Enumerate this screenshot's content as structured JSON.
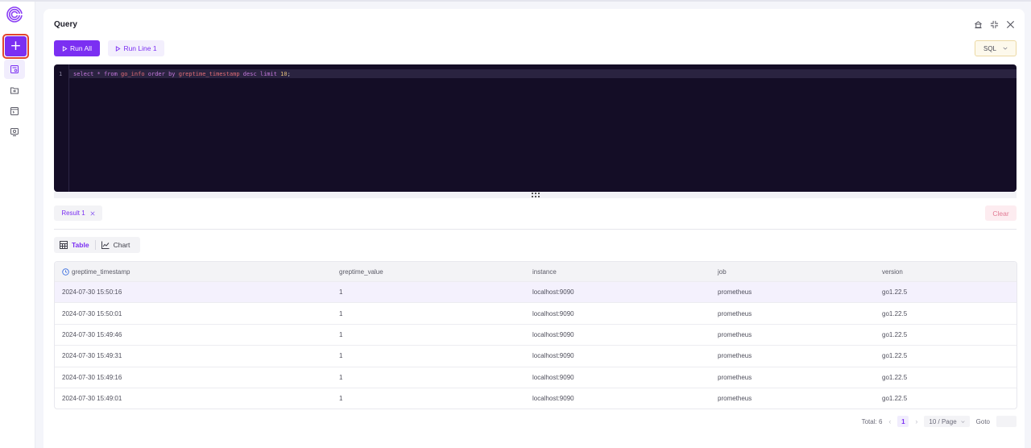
{
  "sidebar": {
    "logo": "greptime-logo",
    "new_button_label": "+",
    "items": [
      {
        "icon": "query-icon",
        "active": true
      },
      {
        "icon": "ingest-icon",
        "active": false
      },
      {
        "icon": "scripts-icon",
        "active": false
      },
      {
        "icon": "dashboard-icon",
        "active": false
      }
    ]
  },
  "query": {
    "title": "Query",
    "header_icons": [
      "home-icon",
      "collapse-icon",
      "close-icon"
    ],
    "run_all_label": "Run All",
    "run_line_label": "Run Line 1",
    "language": "SQL",
    "editor": {
      "line_number": "1",
      "tokens": [
        {
          "t": "select",
          "c": "kw"
        },
        {
          "t": " ",
          "c": "pn"
        },
        {
          "t": "*",
          "c": "op"
        },
        {
          "t": " ",
          "c": "pn"
        },
        {
          "t": "from",
          "c": "kw"
        },
        {
          "t": " ",
          "c": "pn"
        },
        {
          "t": "go_info",
          "c": "id"
        },
        {
          "t": " ",
          "c": "pn"
        },
        {
          "t": "order",
          "c": "kw"
        },
        {
          "t": " ",
          "c": "pn"
        },
        {
          "t": "by",
          "c": "kw"
        },
        {
          "t": " ",
          "c": "pn"
        },
        {
          "t": "greptime_timestamp",
          "c": "id"
        },
        {
          "t": " ",
          "c": "pn"
        },
        {
          "t": "desc",
          "c": "kw"
        },
        {
          "t": " ",
          "c": "pn"
        },
        {
          "t": "limit",
          "c": "kw"
        },
        {
          "t": " ",
          "c": "pn"
        },
        {
          "t": "10",
          "c": "num"
        },
        {
          "t": ";",
          "c": "pn"
        }
      ]
    }
  },
  "results": {
    "tab_label": "Result 1",
    "clear_label": "Clear",
    "view_table_label": "Table",
    "view_chart_label": "Chart",
    "columns": [
      "greptime_timestamp",
      "greptime_value",
      "instance",
      "job",
      "version"
    ],
    "rows": [
      [
        "2024-07-30 15:50:16",
        "1",
        "localhost:9090",
        "prometheus",
        "go1.22.5"
      ],
      [
        "2024-07-30 15:50:01",
        "1",
        "localhost:9090",
        "prometheus",
        "go1.22.5"
      ],
      [
        "2024-07-30 15:49:46",
        "1",
        "localhost:9090",
        "prometheus",
        "go1.22.5"
      ],
      [
        "2024-07-30 15:49:31",
        "1",
        "localhost:9090",
        "prometheus",
        "go1.22.5"
      ],
      [
        "2024-07-30 15:49:16",
        "1",
        "localhost:9090",
        "prometheus",
        "go1.22.5"
      ],
      [
        "2024-07-30 15:49:01",
        "1",
        "localhost:9090",
        "prometheus",
        "go1.22.5"
      ]
    ],
    "pagination": {
      "total_label": "Total: 6",
      "current_page": "1",
      "page_size": "10 / Page",
      "goto_label": "Goto",
      "goto_value": ""
    }
  },
  "colors": {
    "accent": "#7b2ff2",
    "editor_bg": "#140d26",
    "clear": "#e27a94",
    "highlight_row": "#f4f1fd"
  }
}
